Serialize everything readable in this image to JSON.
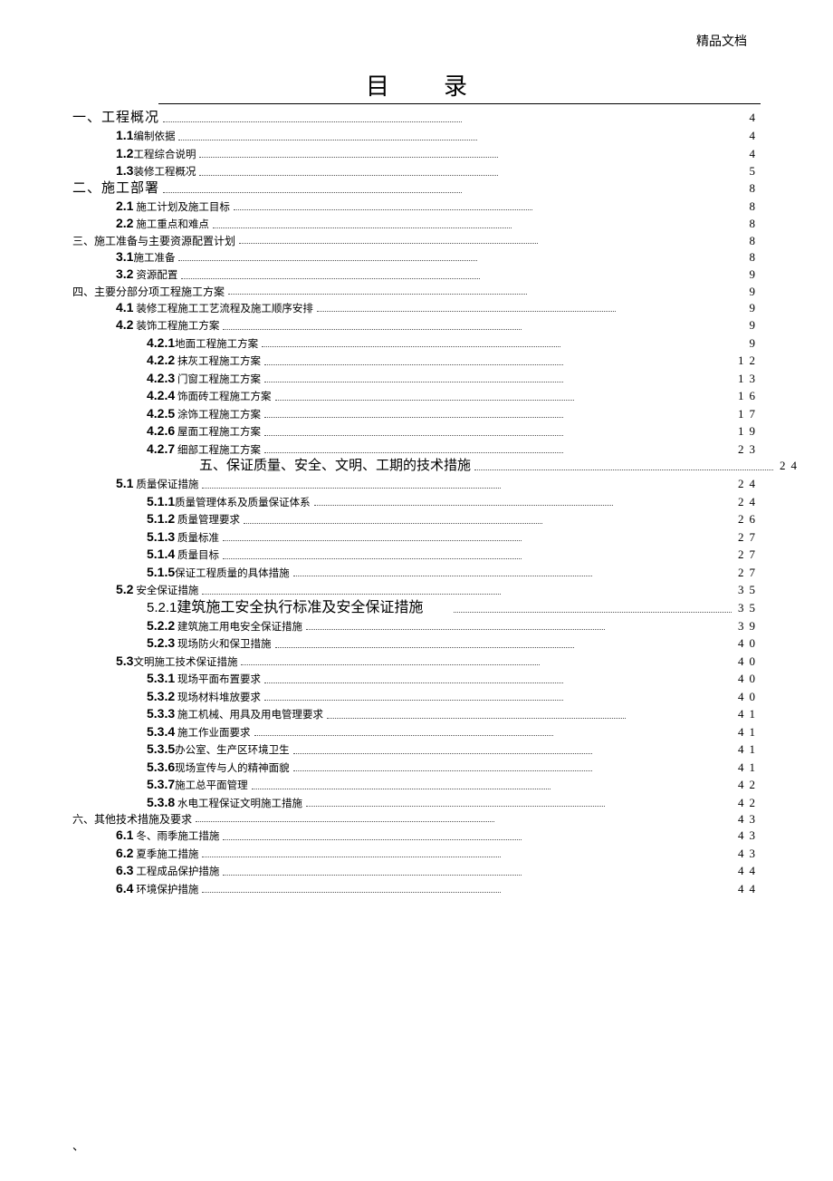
{
  "header": "精品文档",
  "title": "目录",
  "footer": "、",
  "toc": [
    {
      "level": "lvl1",
      "prefix": "",
      "text": "一、工程概况",
      "page": "4",
      "short": true
    },
    {
      "level": "lvl2",
      "prefix": "1.1",
      "text": "编制依据",
      "page": "4",
      "short": true
    },
    {
      "level": "lvl2",
      "prefix": "1.2",
      "text": "工程综合说明",
      "page": "4",
      "short": true
    },
    {
      "level": "lvl2",
      "prefix": "1.3",
      "text": "装修工程概况",
      "page": "5",
      "short": true
    },
    {
      "level": "lvl1",
      "prefix": "",
      "text": "二、施工部署",
      "page": "8",
      "short": true
    },
    {
      "level": "lvl2",
      "prefix": "2.1",
      "text": " 施工计划及施工目标",
      "page": "8",
      "short": true
    },
    {
      "level": "lvl2",
      "prefix": "2.2",
      "text": " 施工重点和难点",
      "page": "8",
      "short": true
    },
    {
      "level": "lvl1",
      "prefix": "",
      "text": "三、施工准备与主要资源配置计划",
      "page": "8",
      "short": true,
      "smallHead": true
    },
    {
      "level": "lvl2",
      "prefix": "3.1",
      "text": "施工准备",
      "page": "8",
      "short": true
    },
    {
      "level": "lvl2",
      "prefix": "3.2",
      "text": " 资源配置",
      "page": "9",
      "short": true
    },
    {
      "level": "lvl1",
      "prefix": "",
      "text": "四、主要分部分项工程施工方案",
      "page": "9",
      "short": true,
      "smallHead": true
    },
    {
      "level": "lvl2",
      "prefix": "4.1",
      "text": " 装修工程施工工艺流程及施工顺序安排",
      "page": "9",
      "short": true
    },
    {
      "level": "lvl2",
      "prefix": "4.2",
      "text": " 装饰工程施工方案",
      "page": "9",
      "short": true
    },
    {
      "level": "lvl3",
      "prefix": "4.2.1",
      "text": "地面工程施工方案",
      "page": "9",
      "short": true
    },
    {
      "level": "lvl3",
      "prefix": "4.2.2",
      "text": " 抹灰工程施工方案",
      "page": "12",
      "short": true
    },
    {
      "level": "lvl3",
      "prefix": "4.2.3",
      "text": " 门窗工程施工方案",
      "page": "13",
      "short": true
    },
    {
      "level": "lvl3",
      "prefix": "4.2.4",
      "text": " 饰面砖工程施工方案",
      "page": "16",
      "short": true
    },
    {
      "level": "lvl3",
      "prefix": "4.2.5",
      "text": " 涂饰工程施工方案",
      "page": "17",
      "short": true
    },
    {
      "level": "lvl3",
      "prefix": "4.2.6",
      "text": " 屋面工程施工方案",
      "page": "19",
      "short": true
    },
    {
      "level": "lvl3",
      "prefix": "4.2.7",
      "text": " 细部工程施工方案",
      "page": "23",
      "short": true
    },
    {
      "level": "centered-line",
      "prefix": "",
      "text": "五、保证质量、安全、文明、工期的技术措施",
      "page": "24",
      "short": true,
      "special": true
    },
    {
      "level": "lvl2",
      "prefix": "5.1",
      "text": " 质量保证措施",
      "page": "24",
      "short": true
    },
    {
      "level": "lvl3",
      "prefix": "5.1.1",
      "text": "质量管理体系及质量保证体系",
      "page": "24",
      "short": true
    },
    {
      "level": "lvl3",
      "prefix": "5.1.2",
      "text": " 质量管理要求",
      "page": "26",
      "short": true
    },
    {
      "level": "lvl3",
      "prefix": "5.1.3",
      "text": " 质量标准",
      "page": "27",
      "short": true
    },
    {
      "level": "lvl3",
      "prefix": "5.1.4",
      "text": " 质量目标",
      "page": "27",
      "short": true
    },
    {
      "level": "lvl3",
      "prefix": "5.1.5",
      "text": "保证工程质量的具体措施",
      "page": "27",
      "short": true
    },
    {
      "level": "lvl2",
      "prefix": "5.2",
      "text": " 安全保证措施",
      "page": "35",
      "short": true
    },
    {
      "level": "lvl3-special",
      "prefix": "5.2.1",
      "text": "建筑施工安全执行标准及安全保证措施",
      "page": "35",
      "short": false,
      "bigLabel": true
    },
    {
      "level": "lvl3",
      "prefix": "5.2.2",
      "text": " 建筑施工用电安全保证措施",
      "page": "39",
      "short": true
    },
    {
      "level": "lvl3",
      "prefix": "5.2.3",
      "text": " 现场防火和保卫措施",
      "page": "40",
      "short": true
    },
    {
      "level": "lvl2",
      "prefix": "5.3",
      "text": "文明施工技术保证措施",
      "page": "40",
      "short": true
    },
    {
      "level": "lvl3",
      "prefix": "5.3.1",
      "text": " 现场平面布置要求",
      "page": "40",
      "short": true
    },
    {
      "level": "lvl3",
      "prefix": "5.3.2",
      "text": " 现场材料堆放要求",
      "page": "40",
      "short": true
    },
    {
      "level": "lvl3",
      "prefix": "5.3.3",
      "text": " 施工机械、用具及用电管理要求",
      "page": "41",
      "short": true
    },
    {
      "level": "lvl3",
      "prefix": "5.3.4",
      "text": " 施工作业面要求",
      "page": "41",
      "short": true
    },
    {
      "level": "lvl3",
      "prefix": "5.3.5",
      "text": "办公室、生产区环境卫生",
      "page": "41",
      "short": true
    },
    {
      "level": "lvl3",
      "prefix": "5.3.6",
      "text": "现场宣传与人的精神面貌",
      "page": "41",
      "short": true
    },
    {
      "level": "lvl3",
      "prefix": "5.3.7",
      "text": "施工总平面管理",
      "page": "42",
      "short": true
    },
    {
      "level": "lvl3",
      "prefix": "5.3.8",
      "text": " 水电工程保证文明施工措施",
      "page": "42",
      "short": true
    },
    {
      "level": "lvl1",
      "prefix": "",
      "text": "六、其他技术措施及要求",
      "page": "43",
      "short": true,
      "smallHead": true
    },
    {
      "level": "lvl2",
      "prefix": "6.1",
      "text": " 冬、雨季施工措施",
      "page": "43",
      "short": true
    },
    {
      "level": "lvl2",
      "prefix": "6.2",
      "text": " 夏季施工措施",
      "page": "43",
      "short": true
    },
    {
      "level": "lvl2",
      "prefix": "6.3",
      "text": " 工程成品保护措施",
      "page": "44",
      "short": true
    },
    {
      "level": "lvl2",
      "prefix": "6.4",
      "text": " 环境保护措施",
      "page": "44",
      "short": true
    }
  ]
}
